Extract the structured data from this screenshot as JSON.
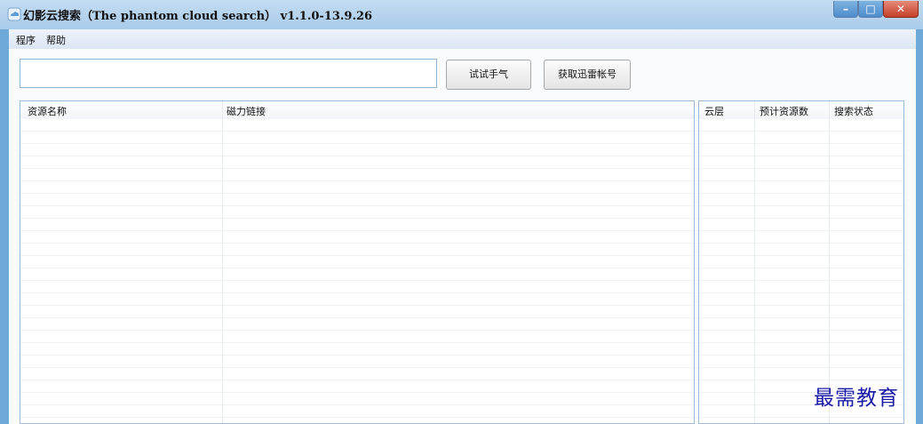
{
  "window": {
    "title": "幻影云搜索（The phantom cloud search） v1.1.0-13.9.26",
    "icon": "cloud-app-icon",
    "controls": {
      "minimize": "minimize-icon",
      "maximize": "maximize-icon",
      "close": "close-icon"
    }
  },
  "menu": {
    "items": [
      {
        "label": "程序"
      },
      {
        "label": "帮助"
      }
    ]
  },
  "toolbar": {
    "search_value": "",
    "search_placeholder": "",
    "try_button": "试试手气",
    "get_account_button": "获取迅雷帐号"
  },
  "results": {
    "columns": [
      "资源名称",
      "磁力链接"
    ],
    "rows": []
  },
  "status_list": {
    "columns": [
      "云层",
      "预计资源数",
      "搜索状态"
    ],
    "rows": []
  },
  "watermark": "最需教育",
  "colors": {
    "frame": "#6fa9d9",
    "close": "#c4402a",
    "watermark": "#1a1aa6"
  }
}
